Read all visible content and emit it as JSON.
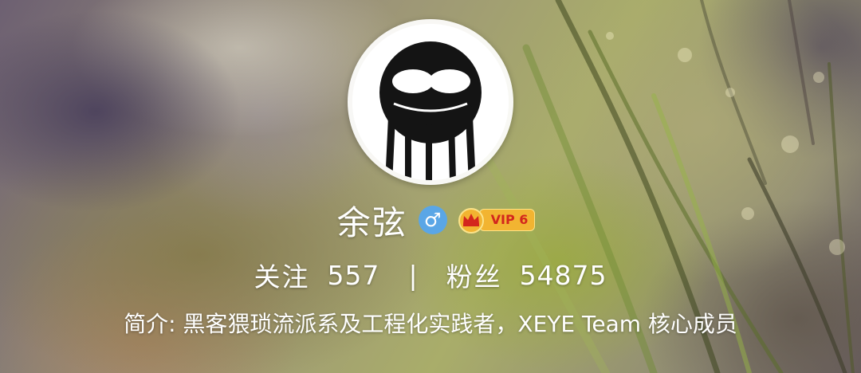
{
  "profile": {
    "name": "余弦",
    "gender_icon": "male-icon",
    "gender_symbol": "♂",
    "vip_label": "VIP 6",
    "vip_icon": "crown-icon"
  },
  "stats": {
    "following_label": "关注",
    "following_count": "557",
    "separator": "|",
    "followers_label": "粉丝",
    "followers_count": "54875"
  },
  "bio": {
    "text": "简介: 黑客猥琐流派系及工程化实践者，XEYE Team 核心成员"
  },
  "colors": {
    "text": "#ffffff",
    "gender_badge": "#5aa6e6",
    "vip_badge": "#f2b431",
    "vip_text": "#d3261d"
  }
}
